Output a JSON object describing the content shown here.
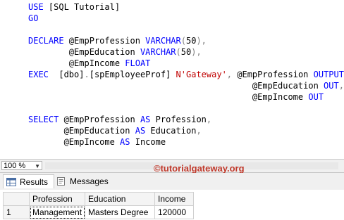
{
  "editor": {
    "lines": [
      {
        "segments": [
          {
            "t": "USE ",
            "c": "kw"
          },
          {
            "t": "[SQL Tutorial]",
            "c": ""
          }
        ]
      },
      {
        "segments": [
          {
            "t": "GO",
            "c": "kw"
          }
        ]
      },
      {
        "segments": []
      },
      {
        "segments": [
          {
            "t": "DECLARE ",
            "c": "kw"
          },
          {
            "t": "@EmpProfession ",
            "c": ""
          },
          {
            "t": "VARCHAR",
            "c": "kw"
          },
          {
            "t": "(",
            "c": "gray"
          },
          {
            "t": "50",
            "c": ""
          },
          {
            "t": "),",
            "c": "gray"
          }
        ]
      },
      {
        "segments": [
          {
            "t": "        @EmpEducation ",
            "c": ""
          },
          {
            "t": "VARCHAR",
            "c": "kw"
          },
          {
            "t": "(",
            "c": "gray"
          },
          {
            "t": "50",
            "c": ""
          },
          {
            "t": "),",
            "c": "gray"
          }
        ]
      },
      {
        "segments": [
          {
            "t": "        @EmpIncome ",
            "c": ""
          },
          {
            "t": "FLOAT",
            "c": "kw"
          }
        ]
      },
      {
        "segments": [
          {
            "t": "EXEC  ",
            "c": "kw"
          },
          {
            "t": "[dbo]",
            "c": ""
          },
          {
            "t": ".",
            "c": "gray"
          },
          {
            "t": "[spEmployeeProf] ",
            "c": ""
          },
          {
            "t": "N'Gateway'",
            "c": "red"
          },
          {
            "t": ", ",
            "c": "gray"
          },
          {
            "t": "@EmpProfession ",
            "c": ""
          },
          {
            "t": "OUTPUT",
            "c": "kw"
          },
          {
            "t": ",",
            "c": "gray"
          }
        ]
      },
      {
        "segments": [
          {
            "t": "                                            @EmpEducation ",
            "c": ""
          },
          {
            "t": "OUT",
            "c": "kw"
          },
          {
            "t": ",",
            "c": "gray"
          }
        ]
      },
      {
        "segments": [
          {
            "t": "                                            @EmpIncome ",
            "c": ""
          },
          {
            "t": "OUT",
            "c": "kw"
          }
        ]
      },
      {
        "segments": []
      },
      {
        "segments": [
          {
            "t": "SELECT ",
            "c": "kw"
          },
          {
            "t": "@EmpProfession ",
            "c": ""
          },
          {
            "t": "AS ",
            "c": "kw"
          },
          {
            "t": "Profession",
            "c": ""
          },
          {
            "t": ",",
            "c": "gray"
          }
        ]
      },
      {
        "segments": [
          {
            "t": "       @EmpEducation ",
            "c": ""
          },
          {
            "t": "AS ",
            "c": "kw"
          },
          {
            "t": "Education",
            "c": ""
          },
          {
            "t": ",",
            "c": "gray"
          }
        ]
      },
      {
        "segments": [
          {
            "t": "       @EmpIncome ",
            "c": ""
          },
          {
            "t": "AS ",
            "c": "kw"
          },
          {
            "t": "Income",
            "c": ""
          }
        ]
      }
    ]
  },
  "statusbar": {
    "zoom": "100 %"
  },
  "watermark": "©tutorialgateway.org",
  "tabs": {
    "results": "Results",
    "messages": "Messages"
  },
  "grid": {
    "columns": [
      "Profession",
      "Education",
      "Income"
    ],
    "rows": [
      {
        "num": "1",
        "cells": [
          "Management",
          "Masters Degree",
          "120000"
        ]
      }
    ]
  }
}
